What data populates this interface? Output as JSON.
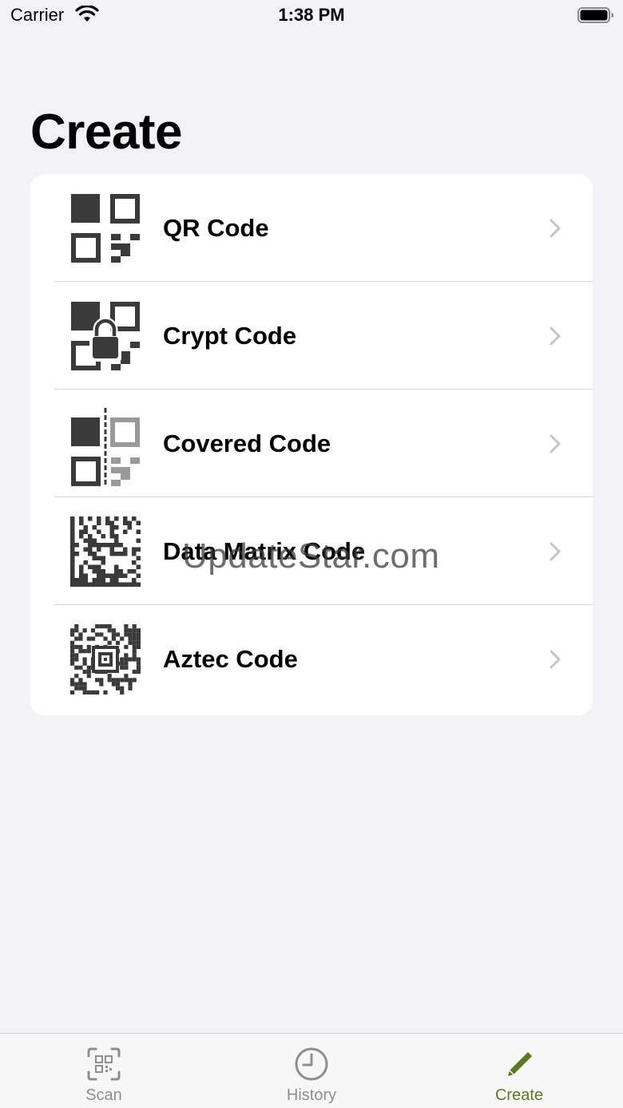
{
  "status_bar": {
    "carrier": "Carrier",
    "time": "1:38 PM"
  },
  "page": {
    "title": "Create"
  },
  "create_list": [
    {
      "label": "QR Code",
      "icon": "qr-code-icon"
    },
    {
      "label": "Crypt Code",
      "icon": "crypt-code-icon"
    },
    {
      "label": "Covered Code",
      "icon": "covered-code-icon"
    },
    {
      "label": "Data Matrix Code",
      "icon": "data-matrix-code-icon"
    },
    {
      "label": "Aztec Code",
      "icon": "aztec-code-icon"
    }
  ],
  "watermark": "UpdateStar.com",
  "tab_bar": {
    "tabs": [
      {
        "label": "Scan",
        "icon": "scan-icon",
        "active": false
      },
      {
        "label": "History",
        "icon": "clock-icon",
        "active": false
      },
      {
        "label": "Create",
        "icon": "pencil-icon",
        "active": true
      }
    ]
  },
  "colors": {
    "background": "#f2f2f7",
    "card": "#ffffff",
    "accent": "#5a7a1e",
    "tab_inactive": "#8e8e93"
  }
}
